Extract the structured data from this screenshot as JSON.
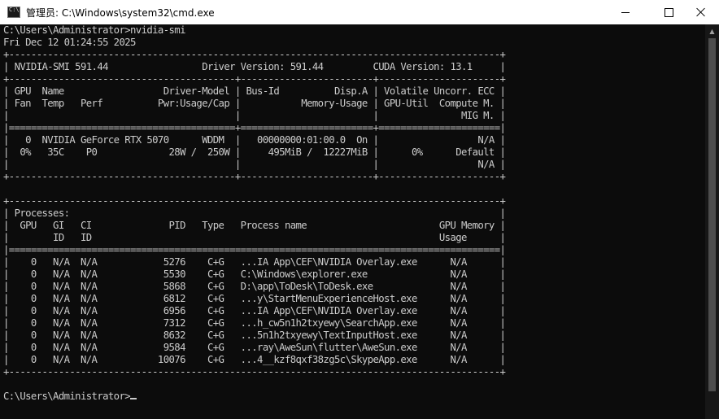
{
  "window": {
    "title": "管理员: C:\\Windows\\system32\\cmd.exe"
  },
  "colors": {
    "console_bg": "#0c0c0c",
    "console_text": "#cccccc",
    "titlebar_bg": "#ffffff"
  },
  "icons": {
    "app": "cmd-icon",
    "minimize": "minimize-icon",
    "maximize": "maximize-icon",
    "close": "close-icon"
  },
  "console": {
    "lines": [
      "C:\\Users\\Administrator>nvidia-smi",
      "Fri Dec 12 01:24:55 2025",
      "+-----------------------------------------------------------------------------------------+",
      "| NVIDIA-SMI 591.44                 Driver Version: 591.44         CUDA Version: 13.1     |",
      "+-----------------------------------------+------------------------+----------------------+",
      "| GPU  Name                  Driver-Model | Bus-Id          Disp.A | Volatile Uncorr. ECC |",
      "| Fan  Temp   Perf          Pwr:Usage/Cap |           Memory-Usage | GPU-Util  Compute M. |",
      "|                                         |                        |               MIG M. |",
      "|=========================================+========================+======================|",
      "|   0  NVIDIA GeForce RTX 5070      WDDM  |   00000000:01:00.0  On |                  N/A |",
      "|  0%   35C    P0             28W /  250W |     495MiB /  12227MiB |      0%      Default |",
      "|                                         |                        |                  N/A |",
      "+-----------------------------------------+------------------------+----------------------+",
      "",
      "+-----------------------------------------------------------------------------------------+",
      "| Processes:                                                                              |",
      "|  GPU   GI   CI              PID   Type   Process name                        GPU Memory |",
      "|        ID   ID                                                               Usage      |",
      "|=========================================================================================|",
      "|    0   N/A  N/A            5276    C+G   ...IA App\\CEF\\NVIDIA Overlay.exe      N/A      |",
      "|    0   N/A  N/A            5530    C+G   C:\\Windows\\explorer.exe               N/A      |",
      "|    0   N/A  N/A            5868    C+G   D:\\app\\ToDesk\\ToDesk.exe              N/A      |",
      "|    0   N/A  N/A            6812    C+G   ...y\\StartMenuExperienceHost.exe      N/A      |",
      "|    0   N/A  N/A            6956    C+G   ...IA App\\CEF\\NVIDIA Overlay.exe      N/A      |",
      "|    0   N/A  N/A            7312    C+G   ...h_cw5n1h2txyewy\\SearchApp.exe      N/A      |",
      "|    0   N/A  N/A            8632    C+G   ...5n1h2txyewy\\TextInputHost.exe      N/A      |",
      "|    0   N/A  N/A            9584    C+G   ...ray\\AweSun\\flutter\\AweSun.exe      N/A      |",
      "|    0   N/A  N/A           10076    C+G   ...4__kzf8qxf38zg5c\\SkypeApp.exe      N/A      |",
      "+-----------------------------------------------------------------------------------------+",
      "",
      "C:\\Users\\Administrator>"
    ]
  }
}
